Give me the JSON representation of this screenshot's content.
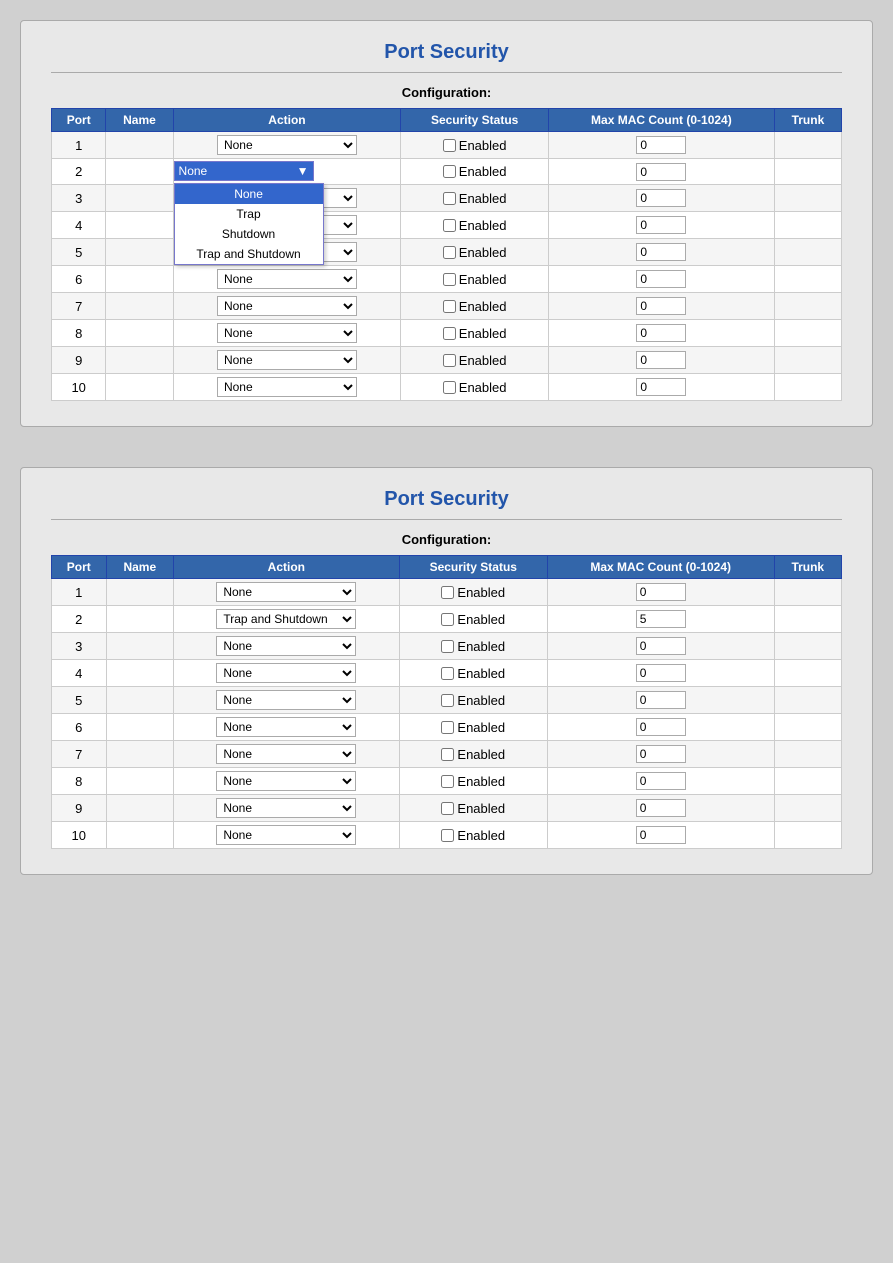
{
  "panel1": {
    "title": "Port Security",
    "config_label": "Configuration:",
    "columns": [
      "Port",
      "Name",
      "Action",
      "Security Status",
      "Max MAC Count (0-1024)",
      "Trunk"
    ],
    "dropdown_options": [
      "None",
      "Trap",
      "Shutdown",
      "Trap and Shutdown"
    ],
    "rows": [
      {
        "port": 1,
        "name": "",
        "action": "None",
        "enabled": false,
        "mac": "0",
        "trunk": ""
      },
      {
        "port": 2,
        "name": "",
        "action": "None",
        "enabled": false,
        "mac": "0",
        "trunk": "",
        "open": true
      },
      {
        "port": 3,
        "name": "",
        "action": "None",
        "enabled": false,
        "mac": "0",
        "trunk": ""
      },
      {
        "port": 4,
        "name": "",
        "action": "None",
        "enabled": false,
        "mac": "0",
        "trunk": ""
      },
      {
        "port": 5,
        "name": "",
        "action": "None",
        "enabled": false,
        "mac": "0",
        "trunk": ""
      },
      {
        "port": 6,
        "name": "",
        "action": "None",
        "enabled": false,
        "mac": "0",
        "trunk": ""
      },
      {
        "port": 7,
        "name": "",
        "action": "None",
        "enabled": false,
        "mac": "0",
        "trunk": ""
      },
      {
        "port": 8,
        "name": "",
        "action": "None",
        "enabled": false,
        "mac": "0",
        "trunk": ""
      },
      {
        "port": 9,
        "name": "",
        "action": "None",
        "enabled": false,
        "mac": "0",
        "trunk": ""
      },
      {
        "port": 10,
        "name": "",
        "action": "None",
        "enabled": false,
        "mac": "0",
        "trunk": ""
      }
    ]
  },
  "panel2": {
    "title": "Port Security",
    "config_label": "Configuration:",
    "columns": [
      "Port",
      "Name",
      "Action",
      "Security Status",
      "Max MAC Count (0-1024)",
      "Trunk"
    ],
    "rows": [
      {
        "port": 1,
        "name": "",
        "action": "None",
        "enabled": false,
        "mac": "0",
        "trunk": ""
      },
      {
        "port": 2,
        "name": "",
        "action": "Trap and Shutdown",
        "enabled": false,
        "mac": "5",
        "trunk": ""
      },
      {
        "port": 3,
        "name": "",
        "action": "None",
        "enabled": false,
        "mac": "0",
        "trunk": ""
      },
      {
        "port": 4,
        "name": "",
        "action": "None",
        "enabled": false,
        "mac": "0",
        "trunk": ""
      },
      {
        "port": 5,
        "name": "",
        "action": "None",
        "enabled": false,
        "mac": "0",
        "trunk": ""
      },
      {
        "port": 6,
        "name": "",
        "action": "None",
        "enabled": false,
        "mac": "0",
        "trunk": ""
      },
      {
        "port": 7,
        "name": "",
        "action": "None",
        "enabled": false,
        "mac": "0",
        "trunk": ""
      },
      {
        "port": 8,
        "name": "",
        "action": "None",
        "enabled": false,
        "mac": "0",
        "trunk": ""
      },
      {
        "port": 9,
        "name": "",
        "action": "None",
        "enabled": false,
        "mac": "0",
        "trunk": ""
      },
      {
        "port": 10,
        "name": "",
        "action": "None",
        "enabled": false,
        "mac": "0",
        "trunk": ""
      }
    ]
  },
  "labels": {
    "enabled": "Enabled",
    "none": "None",
    "trap": "Trap",
    "shutdown": "Shutdown",
    "trap_and_shutdown": "Trap and Shutdown"
  }
}
